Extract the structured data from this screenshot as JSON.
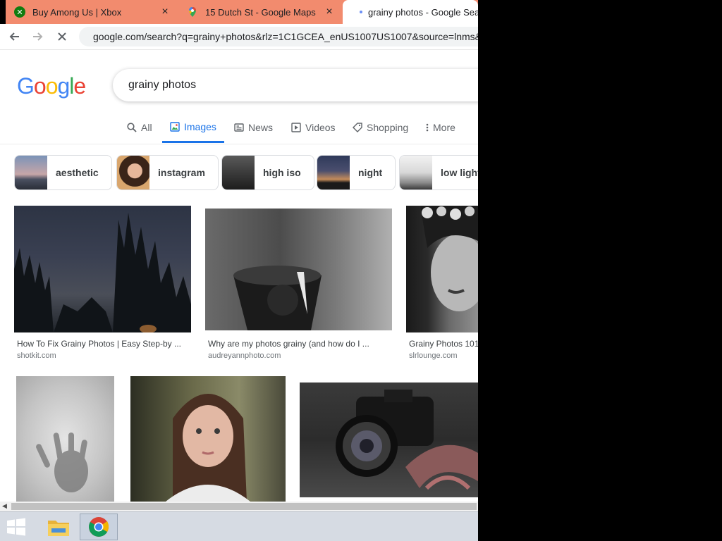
{
  "browser": {
    "tabs": [
      {
        "title": "Buy Among Us | Xbox",
        "icon": "xbox-icon",
        "close": "×"
      },
      {
        "title": "15 Dutch St - Google Maps",
        "icon": "maps-icon",
        "close": "×"
      },
      {
        "title": "grainy photos - Google Search",
        "icon": "loading-dot-icon"
      }
    ],
    "url": "google.com/search?q=grainy+photos&rlz=1C1GCEA_enUS1007US1007&source=lnms&tbm=isch"
  },
  "google": {
    "logo": "Google",
    "query": "grainy photos",
    "nav": [
      {
        "label": "All",
        "icon": "search-icon"
      },
      {
        "label": "Images",
        "icon": "images-icon"
      },
      {
        "label": "News",
        "icon": "news-icon"
      },
      {
        "label": "Videos",
        "icon": "play-icon"
      },
      {
        "label": "Shopping",
        "icon": "tag-icon"
      },
      {
        "label": "More",
        "icon": "more-vert-icon"
      }
    ],
    "chips": [
      "aesthetic",
      "instagram",
      "high iso",
      "night",
      "low light"
    ]
  },
  "results": [
    {
      "caption": "How To Fix Grainy Photos | Easy Step-by ...",
      "source": "shotkit.com"
    },
    {
      "caption": "Why are my photos grainy (and how do I ...",
      "source": "audreyannphoto.com"
    },
    {
      "caption": "Grainy Photos 101",
      "source": "slrlounge.com"
    }
  ],
  "colors": {
    "accent": "#1a73e8",
    "tabstrip": "#f28b6e"
  }
}
